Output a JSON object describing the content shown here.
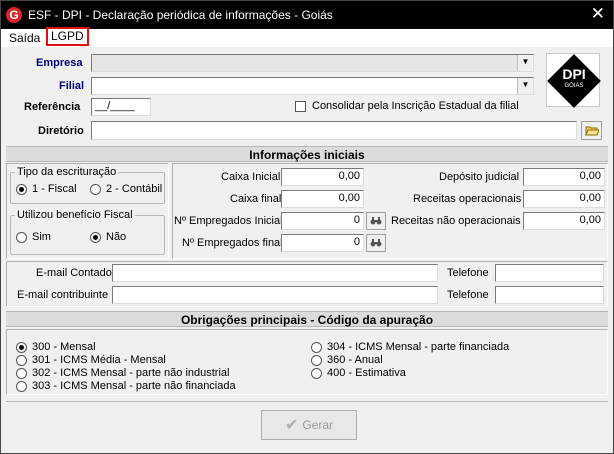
{
  "window": {
    "title": "ESF - DPI - Declaração periódica de informações - Goiás",
    "app_icon": "G",
    "close_glyph": "✕"
  },
  "menu": {
    "items": [
      {
        "label": "Saída"
      },
      {
        "label": "LGPD",
        "highlighted": true
      }
    ]
  },
  "header_form": {
    "empresa_label": "Empresa",
    "empresa_value": "",
    "filial_label": "Filial",
    "filial_value": "",
    "referencia_label": "Referência",
    "referencia_value": "__/____",
    "consolidar_label": "Consolidar pela Inscrição Estadual da filial",
    "consolidar_checked": false,
    "diretorio_label": "Diretório",
    "diretorio_value": ""
  },
  "logo": {
    "text": "DPI",
    "subtext": "GOIAS"
  },
  "informacoes_iniciais": {
    "section_title": "Informações iniciais",
    "tipo_escrituracao": {
      "title": "Tipo da escrituração",
      "options": [
        {
          "label": "1 - Fiscal",
          "selected": true
        },
        {
          "label": "2 - Contábil",
          "selected": false
        }
      ]
    },
    "beneficio_fiscal": {
      "title": "Utilizou benefício Fiscal",
      "options": [
        {
          "label": "Sim",
          "selected": false
        },
        {
          "label": "Não",
          "selected": true
        }
      ]
    },
    "caixa_inicial_label": "Caixa Inicial",
    "caixa_inicial_value": "0,00",
    "caixa_final_label": "Caixa final",
    "caixa_final_value": "0,00",
    "empregados_inicial_label": "Nº Empregados Inicial",
    "empregados_inicial_value": "0",
    "empregados_final_label": "Nº Empregados final",
    "empregados_final_value": "0",
    "deposito_judicial_label": "Depósito judicial",
    "deposito_judicial_value": "0,00",
    "receitas_operacionais_label": "Receitas operacionais",
    "receitas_operacionais_value": "0,00",
    "receitas_nao_operacionais_label": "Receitas não operacionais",
    "receitas_nao_operacionais_value": "0,00",
    "binoculars_icon": "binoculars-icon"
  },
  "contatos": {
    "email_contador_label": "E-mail Contador",
    "email_contador_value": "",
    "email_contribuinte_label": "E-mail contribuinte",
    "email_contribuinte_value": "",
    "telefone1_label": "Telefone",
    "telefone1_value": "",
    "telefone2_label": "Telefone",
    "telefone2_value": ""
  },
  "obrigacoes": {
    "section_title": "Obrigações principais - Código da apuração",
    "options_left": [
      {
        "label": "300 - Mensal",
        "selected": true
      },
      {
        "label": "301 - ICMS Média - Mensal",
        "selected": false
      },
      {
        "label": "302 - ICMS Mensal - parte não industrial",
        "selected": false
      },
      {
        "label": "303 - ICMS Mensal - parte não financiada",
        "selected": false
      }
    ],
    "options_right": [
      {
        "label": "304 - ICMS Mensal - parte financiada",
        "selected": false
      },
      {
        "label": "360 - Anual",
        "selected": false
      },
      {
        "label": "400 - Estimativa",
        "selected": false
      }
    ]
  },
  "footer": {
    "gerar_label": "Gerar",
    "gerar_enabled": false
  }
}
